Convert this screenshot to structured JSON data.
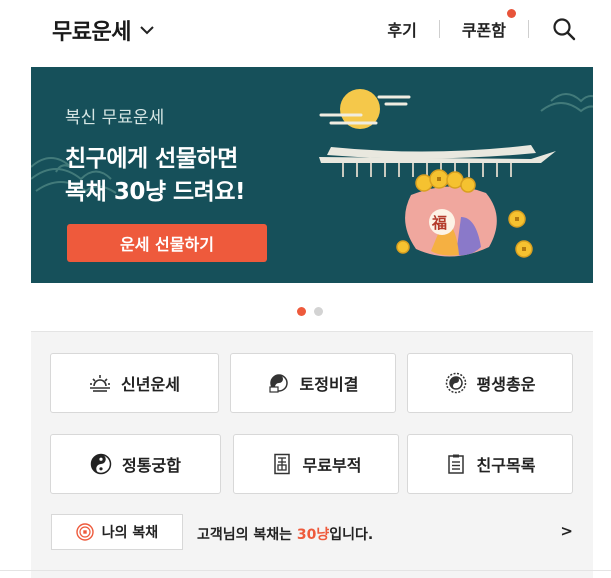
{
  "header": {
    "title": "무료운세",
    "links": [
      "후기",
      "쿠폰함"
    ],
    "search_icon": "search-icon",
    "menu_icon": "chevron-down-icon",
    "coupon_badge_color": "#e8543a"
  },
  "banner": {
    "subtitle": "복신 무료운세",
    "headline_line1": "친구에게 선물하면",
    "headline_line2": "복채 30냥 드려요!",
    "button_label": "운세 선물하기",
    "bg_color": "#16505a",
    "accent_color": "#ee5a3c",
    "pouch_char": "福",
    "pages": 2,
    "current_page": 1
  },
  "menu": {
    "items": [
      {
        "label": "신년운세",
        "icon": "sunrise-icon"
      },
      {
        "label": "토정비결",
        "icon": "yin-yang-book-icon"
      },
      {
        "label": "평생총운",
        "icon": "compass-icon"
      },
      {
        "label": "정통궁합",
        "icon": "yin-yang-icon"
      },
      {
        "label": "무료부적",
        "icon": "talisman-icon"
      },
      {
        "label": "친구목록",
        "icon": "clipboard-list-icon"
      }
    ]
  },
  "fee": {
    "button_label": "나의 복채",
    "message_prefix": "고객님의 복채는 ",
    "amount": "30냥",
    "message_suffix": "입니다.",
    "arrow": ">"
  }
}
